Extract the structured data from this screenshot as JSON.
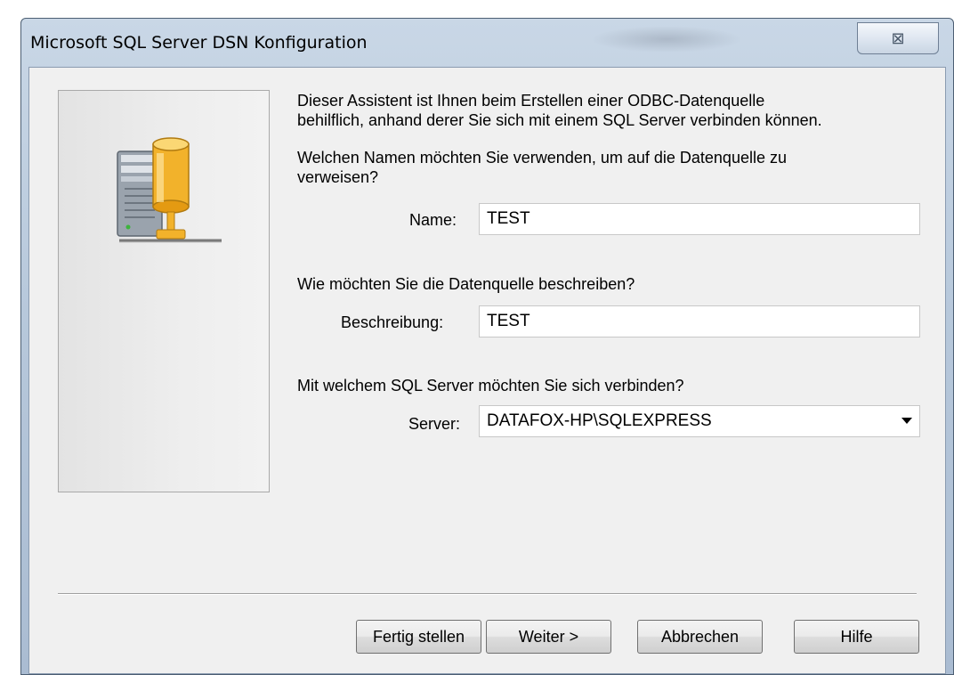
{
  "window": {
    "title": "Microsoft SQL Server DSN Konfiguration",
    "close_glyph": "⊠"
  },
  "intro": {
    "line1": "Dieser Assistent ist Ihnen beim Erstellen einer ODBC-Datenquelle",
    "line2": "behilflich, anhand derer Sie sich mit einem SQL Server verbinden können."
  },
  "name_section": {
    "question_line1": "Welchen Namen möchten Sie verwenden, um auf die Datenquelle zu",
    "question_line2": "verweisen?",
    "label": "Name:",
    "value": "TEST"
  },
  "description_section": {
    "question": "Wie möchten Sie die Datenquelle beschreiben?",
    "label": "Beschreibung:",
    "value": "TEST"
  },
  "server_section": {
    "question": "Mit welchem SQL Server möchten Sie sich verbinden?",
    "label": "Server:",
    "value": "DATAFOX-HP\\SQLEXPRESS"
  },
  "buttons": {
    "finish": "Fertig stellen",
    "next": "Weiter >",
    "cancel": "Abbrechen",
    "help": "Hilfe"
  },
  "icons": {
    "server_icon": "server-database-icon",
    "close_icon": "close-icon",
    "dropdown_icon": "chevron-down-icon"
  }
}
